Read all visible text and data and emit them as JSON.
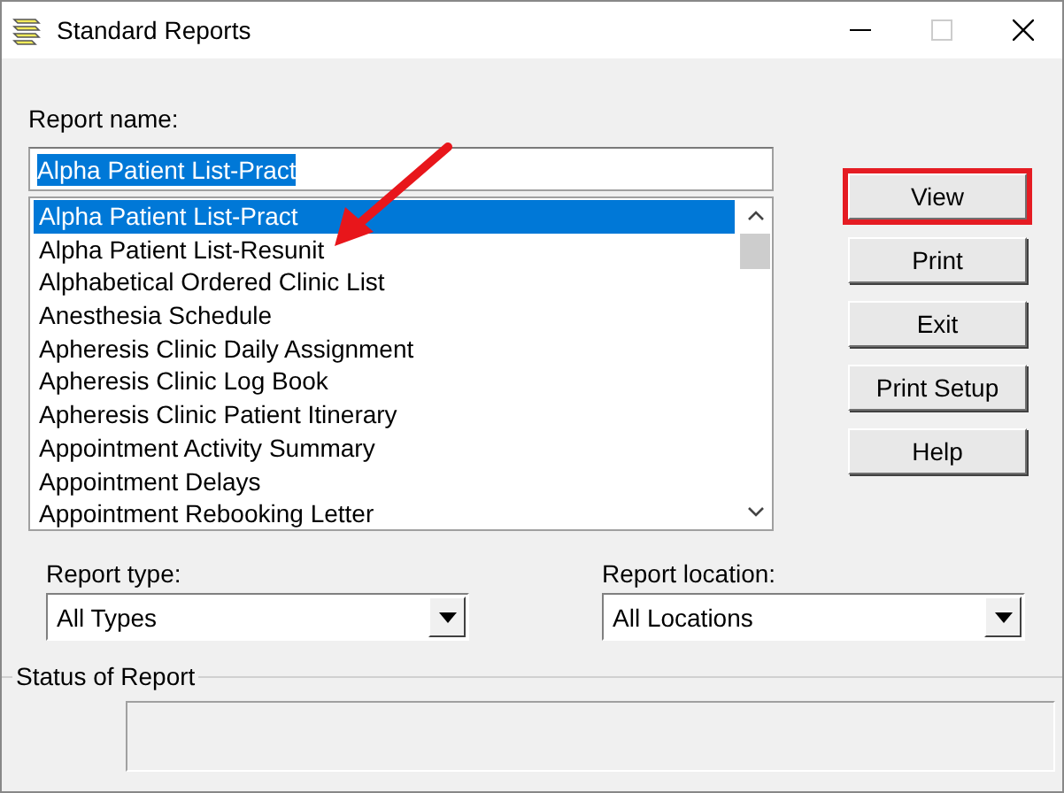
{
  "window": {
    "title": "Standard Reports"
  },
  "report_name": {
    "label": "Report name:",
    "value": "Alpha Patient List-Pract"
  },
  "reports": [
    {
      "label": "Alpha Patient List-Pract",
      "selected": true
    },
    {
      "label": "Alpha Patient List-Resunit",
      "selected": false
    },
    {
      "label": "Alphabetical Ordered Clinic List",
      "selected": false
    },
    {
      "label": "Anesthesia Schedule",
      "selected": false
    },
    {
      "label": "Apheresis Clinic Daily Assignment",
      "selected": false
    },
    {
      "label": "Apheresis Clinic Log Book",
      "selected": false
    },
    {
      "label": "Apheresis Clinic Patient Itinerary",
      "selected": false
    },
    {
      "label": "Appointment Activity Summary",
      "selected": false
    },
    {
      "label": "Appointment Delays",
      "selected": false
    },
    {
      "label": "Appointment Rebooking Letter",
      "selected": false
    }
  ],
  "buttons": [
    {
      "label": "View",
      "highlighted": true
    },
    {
      "label": "Print",
      "highlighted": false
    },
    {
      "label": "Exit",
      "highlighted": false
    },
    {
      "label": "Print Setup",
      "highlighted": false
    },
    {
      "label": "Help",
      "highlighted": false
    }
  ],
  "report_type": {
    "label": "Report type:",
    "value": "All Types"
  },
  "report_location": {
    "label": "Report location:",
    "value": "All Locations"
  },
  "status": {
    "label": "Status of Report"
  }
}
